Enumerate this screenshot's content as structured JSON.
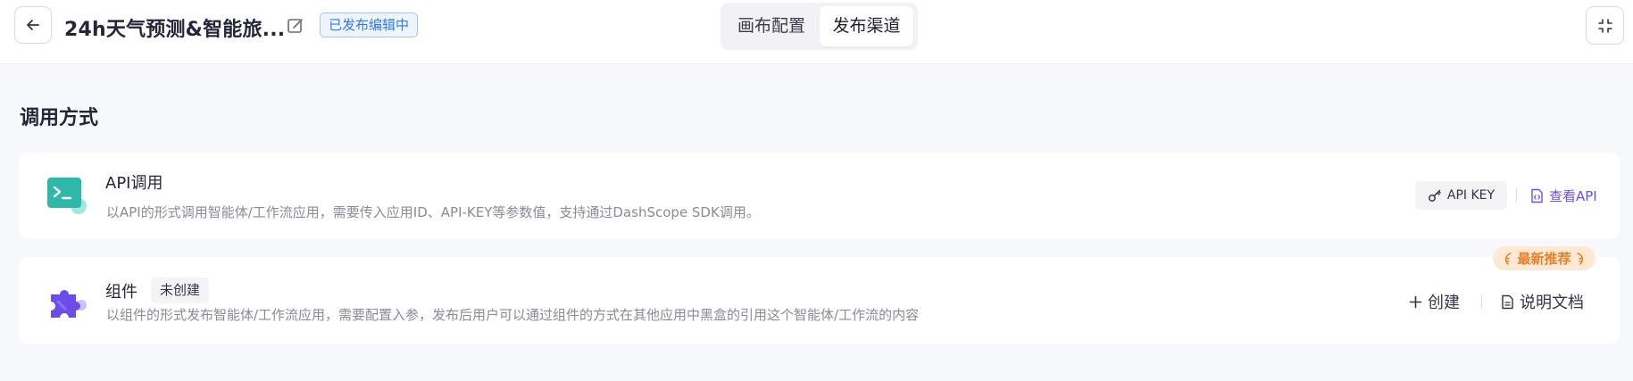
{
  "header": {
    "app_title": "24h天气预测&智能旅...",
    "status_badge": "已发布编辑中",
    "tabs": [
      {
        "label": "画布配置",
        "active": false
      },
      {
        "label": "发布渠道",
        "active": true
      }
    ],
    "icons": {
      "back": "arrow-left-icon",
      "edit": "edit-icon",
      "collapse": "collapse-icon"
    }
  },
  "section": {
    "title": "调用方式"
  },
  "api_card": {
    "title": "API调用",
    "description": "以API的形式调用智能体/工作流应用，需要传入应用ID、API-KEY等参数值，支持通过DashScope SDK调用。",
    "apikey_label": "API KEY",
    "view_api_label": "查看API",
    "icon": "terminal-icon",
    "accent": "#2fb8a8"
  },
  "component_card": {
    "title": "组件",
    "tag": "未创建",
    "description": "以组件的形式发布智能体/工作流应用，需要配置入参，发布后用户可以通过组件的方式在其他应用中黑盒的引用这个智能体/工作流的内容",
    "recommend_badge": "最新推荐",
    "create_label": "创建",
    "docs_label": "说明文档",
    "icon": "puzzle-icon",
    "accent": "#6c4de8"
  }
}
